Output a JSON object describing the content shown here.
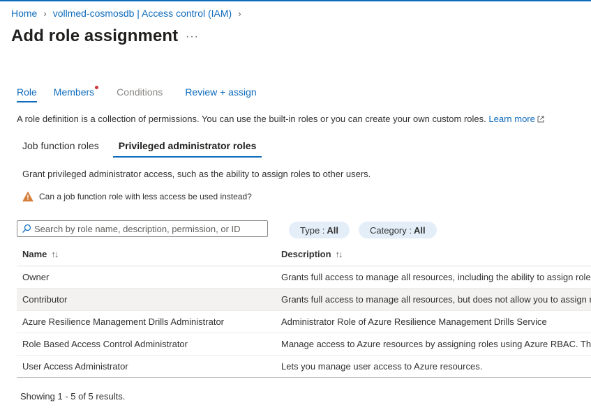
{
  "breadcrumb": [
    "Home",
    "vollmed-cosmosdb | Access control (IAM)"
  ],
  "page": {
    "title": "Add role assignment",
    "more": "···"
  },
  "tabs": [
    {
      "label": "Role",
      "state": "active"
    },
    {
      "label": "Members",
      "state": "normal",
      "dot": true
    },
    {
      "label": "Conditions",
      "state": "disabled"
    },
    {
      "label": "Review + assign",
      "state": "normal"
    }
  ],
  "description": {
    "text": "A role definition is a collection of permissions. You can use the built-in roles or you can create your own custom roles.",
    "link": "Learn more"
  },
  "subtabs": [
    {
      "label": "Job function roles",
      "active": false
    },
    {
      "label": "Privileged administrator roles",
      "active": true
    }
  ],
  "grant_text": "Grant privileged administrator access, such as the ability to assign roles to other users.",
  "warning": "Can a job function role with less access be used instead?",
  "search": {
    "placeholder": "Search by role name, description, permission, or ID",
    "value": ""
  },
  "filters": [
    {
      "label": "Type :",
      "value": "All"
    },
    {
      "label": "Category :",
      "value": "All"
    }
  ],
  "table": {
    "columns": [
      "Name",
      "Description"
    ],
    "rows": [
      {
        "name": "Owner",
        "description": "Grants full access to manage all resources, including the ability to assign roles in Azure RBAC."
      },
      {
        "name": "Contributor",
        "description": "Grants full access to manage all resources, but does not allow you to assign roles in Azure RBAC."
      },
      {
        "name": "Azure Resilience Management Drills Administrator",
        "description": "Administrator Role of Azure Resilience Management Drills Service"
      },
      {
        "name": "Role Based Access Control Administrator",
        "description": "Manage access to Azure resources by assigning roles using Azure RBAC. This role does not allow you to manage access using other ways."
      },
      {
        "name": "User Access Administrator",
        "description": "Lets you manage user access to Azure resources."
      }
    ],
    "hover_row": 1
  },
  "footer": "Showing 1 - 5 of 5 results.",
  "colors": {
    "accent": "#0f6cbd",
    "warning": "#d67f3c",
    "pill": "#e3eef9",
    "dot": "#d13438"
  }
}
